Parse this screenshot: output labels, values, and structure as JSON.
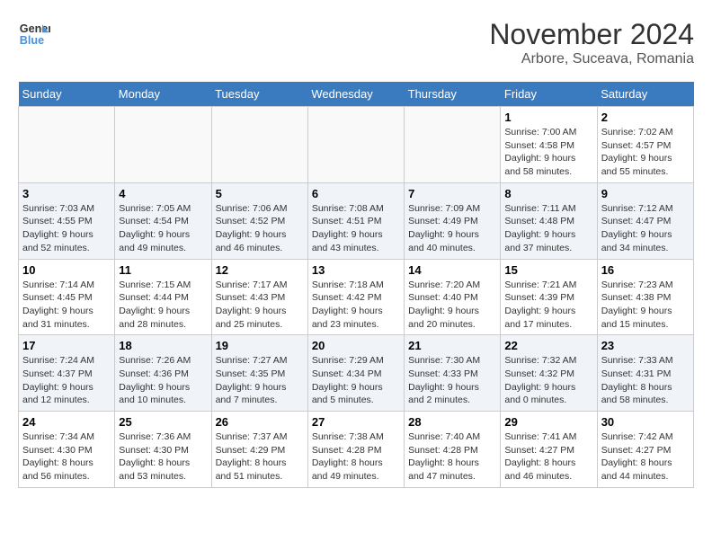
{
  "logo": {
    "line1": "General",
    "line2": "Blue"
  },
  "title": "November 2024",
  "subtitle": "Arbore, Suceava, Romania",
  "weekdays": [
    "Sunday",
    "Monday",
    "Tuesday",
    "Wednesday",
    "Thursday",
    "Friday",
    "Saturday"
  ],
  "weeks": [
    [
      {
        "day": "",
        "info": ""
      },
      {
        "day": "",
        "info": ""
      },
      {
        "day": "",
        "info": ""
      },
      {
        "day": "",
        "info": ""
      },
      {
        "day": "",
        "info": ""
      },
      {
        "day": "1",
        "info": "Sunrise: 7:00 AM\nSunset: 4:58 PM\nDaylight: 9 hours and 58 minutes."
      },
      {
        "day": "2",
        "info": "Sunrise: 7:02 AM\nSunset: 4:57 PM\nDaylight: 9 hours and 55 minutes."
      }
    ],
    [
      {
        "day": "3",
        "info": "Sunrise: 7:03 AM\nSunset: 4:55 PM\nDaylight: 9 hours and 52 minutes."
      },
      {
        "day": "4",
        "info": "Sunrise: 7:05 AM\nSunset: 4:54 PM\nDaylight: 9 hours and 49 minutes."
      },
      {
        "day": "5",
        "info": "Sunrise: 7:06 AM\nSunset: 4:52 PM\nDaylight: 9 hours and 46 minutes."
      },
      {
        "day": "6",
        "info": "Sunrise: 7:08 AM\nSunset: 4:51 PM\nDaylight: 9 hours and 43 minutes."
      },
      {
        "day": "7",
        "info": "Sunrise: 7:09 AM\nSunset: 4:49 PM\nDaylight: 9 hours and 40 minutes."
      },
      {
        "day": "8",
        "info": "Sunrise: 7:11 AM\nSunset: 4:48 PM\nDaylight: 9 hours and 37 minutes."
      },
      {
        "day": "9",
        "info": "Sunrise: 7:12 AM\nSunset: 4:47 PM\nDaylight: 9 hours and 34 minutes."
      }
    ],
    [
      {
        "day": "10",
        "info": "Sunrise: 7:14 AM\nSunset: 4:45 PM\nDaylight: 9 hours and 31 minutes."
      },
      {
        "day": "11",
        "info": "Sunrise: 7:15 AM\nSunset: 4:44 PM\nDaylight: 9 hours and 28 minutes."
      },
      {
        "day": "12",
        "info": "Sunrise: 7:17 AM\nSunset: 4:43 PM\nDaylight: 9 hours and 25 minutes."
      },
      {
        "day": "13",
        "info": "Sunrise: 7:18 AM\nSunset: 4:42 PM\nDaylight: 9 hours and 23 minutes."
      },
      {
        "day": "14",
        "info": "Sunrise: 7:20 AM\nSunset: 4:40 PM\nDaylight: 9 hours and 20 minutes."
      },
      {
        "day": "15",
        "info": "Sunrise: 7:21 AM\nSunset: 4:39 PM\nDaylight: 9 hours and 17 minutes."
      },
      {
        "day": "16",
        "info": "Sunrise: 7:23 AM\nSunset: 4:38 PM\nDaylight: 9 hours and 15 minutes."
      }
    ],
    [
      {
        "day": "17",
        "info": "Sunrise: 7:24 AM\nSunset: 4:37 PM\nDaylight: 9 hours and 12 minutes."
      },
      {
        "day": "18",
        "info": "Sunrise: 7:26 AM\nSunset: 4:36 PM\nDaylight: 9 hours and 10 minutes."
      },
      {
        "day": "19",
        "info": "Sunrise: 7:27 AM\nSunset: 4:35 PM\nDaylight: 9 hours and 7 minutes."
      },
      {
        "day": "20",
        "info": "Sunrise: 7:29 AM\nSunset: 4:34 PM\nDaylight: 9 hours and 5 minutes."
      },
      {
        "day": "21",
        "info": "Sunrise: 7:30 AM\nSunset: 4:33 PM\nDaylight: 9 hours and 2 minutes."
      },
      {
        "day": "22",
        "info": "Sunrise: 7:32 AM\nSunset: 4:32 PM\nDaylight: 9 hours and 0 minutes."
      },
      {
        "day": "23",
        "info": "Sunrise: 7:33 AM\nSunset: 4:31 PM\nDaylight: 8 hours and 58 minutes."
      }
    ],
    [
      {
        "day": "24",
        "info": "Sunrise: 7:34 AM\nSunset: 4:30 PM\nDaylight: 8 hours and 56 minutes."
      },
      {
        "day": "25",
        "info": "Sunrise: 7:36 AM\nSunset: 4:30 PM\nDaylight: 8 hours and 53 minutes."
      },
      {
        "day": "26",
        "info": "Sunrise: 7:37 AM\nSunset: 4:29 PM\nDaylight: 8 hours and 51 minutes."
      },
      {
        "day": "27",
        "info": "Sunrise: 7:38 AM\nSunset: 4:28 PM\nDaylight: 8 hours and 49 minutes."
      },
      {
        "day": "28",
        "info": "Sunrise: 7:40 AM\nSunset: 4:28 PM\nDaylight: 8 hours and 47 minutes."
      },
      {
        "day": "29",
        "info": "Sunrise: 7:41 AM\nSunset: 4:27 PM\nDaylight: 8 hours and 46 minutes."
      },
      {
        "day": "30",
        "info": "Sunrise: 7:42 AM\nSunset: 4:27 PM\nDaylight: 8 hours and 44 minutes."
      }
    ]
  ]
}
